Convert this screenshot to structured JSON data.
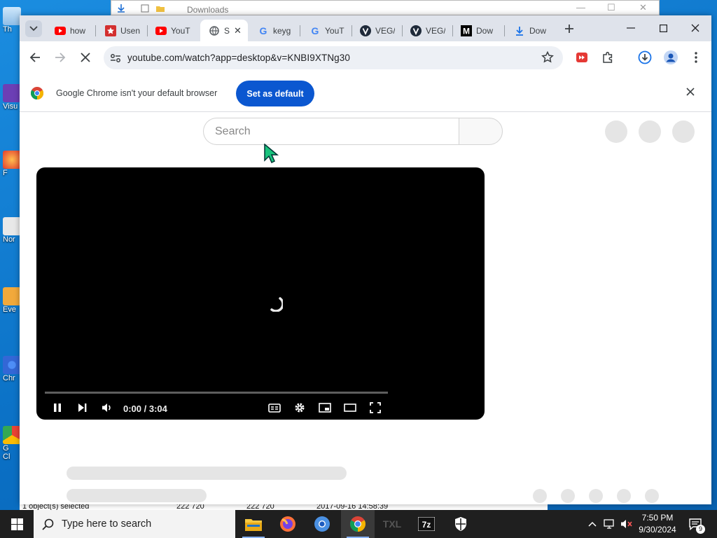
{
  "desktop": {
    "icons": [
      {
        "label": "Th"
      },
      {
        "label": "Visu"
      },
      {
        "label": "F"
      },
      {
        "label": "Nor"
      },
      {
        "label": "Eve"
      },
      {
        "label": "Chr"
      },
      {
        "label": "G"
      },
      {
        "label": "Cl"
      }
    ]
  },
  "explorer_bg": {
    "title": "Downloads",
    "status": {
      "selected": "1 object(s) selected",
      "size1": "222 720",
      "size2": "222 720",
      "date": "2017-09-16 14:58:39"
    }
  },
  "browser": {
    "tabs": [
      {
        "title": "how",
        "icon": "youtube-icon"
      },
      {
        "title": "Usen",
        "icon": "star-site-icon"
      },
      {
        "title": "YouT",
        "icon": "youtube-icon"
      },
      {
        "title": "S",
        "icon": "globe-loading-icon",
        "active": true
      },
      {
        "title": "keyg",
        "icon": "google-icon"
      },
      {
        "title": "YouT",
        "icon": "google-icon"
      },
      {
        "title": "VEG/",
        "icon": "vegas-icon"
      },
      {
        "title": "VEG/",
        "icon": "vegas-icon"
      },
      {
        "title": "Dow",
        "icon": "medium-icon"
      },
      {
        "title": "Dow",
        "icon": "download-icon"
      }
    ],
    "url": "youtube.com/watch?app=desktop&v=KNBI9XTNg30",
    "infobar": {
      "message": "Google Chrome isn't your default browser",
      "button": "Set as default"
    }
  },
  "youtube": {
    "search_placeholder": "Search",
    "player": {
      "current_time": "0:00",
      "duration": "3:04",
      "time_display": "0:00 / 3:04"
    }
  },
  "taskbar": {
    "search_placeholder": "Type here to search",
    "apps": [
      "file-explorer-icon",
      "firefox-icon",
      "chromium-icon",
      "chrome-icon",
      "txt-icon",
      "7zip-icon",
      "security-shield-icon"
    ],
    "clock_time": "7:50 PM",
    "clock_date": "9/30/2024",
    "notification_count": "9"
  },
  "colors": {
    "set_default_button": "#0b57d0",
    "tabstrip": "#dfe3eb",
    "taskbar": "#1f1f1f",
    "youtube_red": "#ff0000"
  }
}
